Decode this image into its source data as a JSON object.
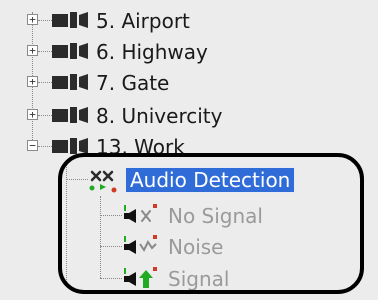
{
  "tree": {
    "cameras": [
      {
        "label": "5. Airport",
        "expander": "+",
        "icon": "camera-icon"
      },
      {
        "label": "6. Highway",
        "expander": "+",
        "icon": "camera-icon"
      },
      {
        "label": "7. Gate",
        "expander": "+",
        "icon": "camera-icon"
      },
      {
        "label": "8. Univercity",
        "expander": "+",
        "icon": "camera-icon"
      },
      {
        "label": "13. Work",
        "expander": "−",
        "icon": "camera-icon"
      }
    ],
    "detector": {
      "label": "Audio Detection",
      "icon": "audio-detector-icon",
      "selected": true
    },
    "events": [
      {
        "label": "No Signal",
        "icon": "speaker-no-signal-icon"
      },
      {
        "label": "Noise",
        "icon": "speaker-noise-icon"
      },
      {
        "label": "Signal",
        "icon": "speaker-signal-icon"
      }
    ]
  },
  "colors": {
    "selection": "#2f6cd8",
    "background": "#ececec",
    "disabled_text": "#9a9a9a",
    "highlight_ring": "#000000"
  }
}
